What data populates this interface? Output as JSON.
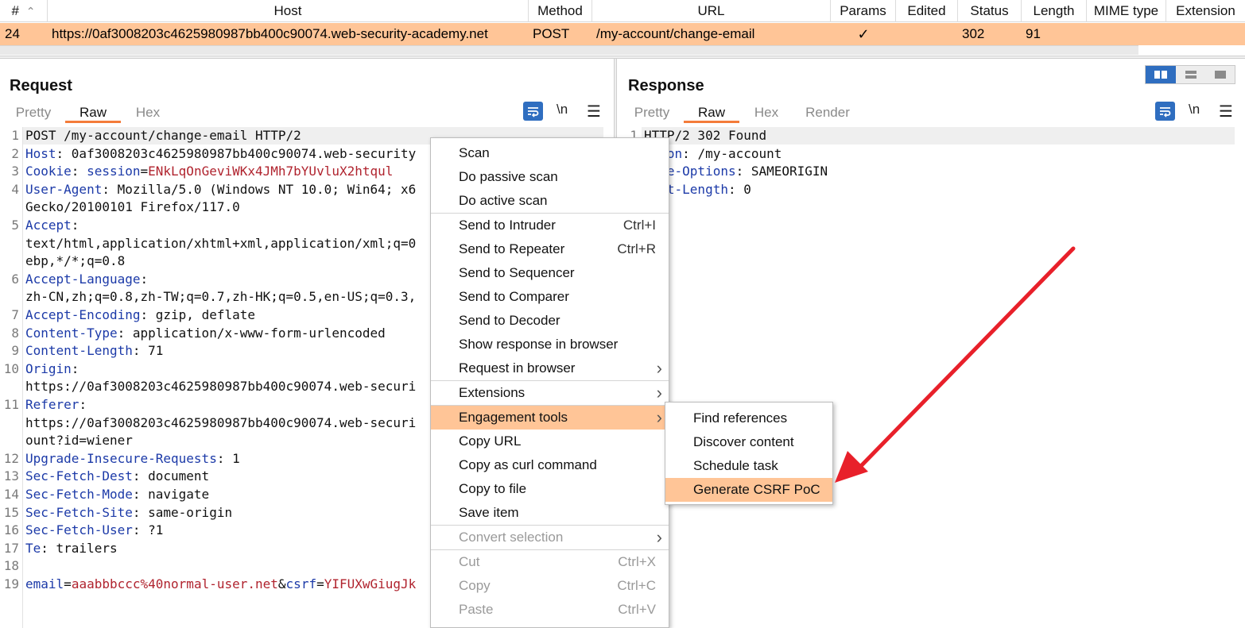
{
  "history": {
    "columns": [
      "#",
      "Host",
      "Method",
      "URL",
      "Params",
      "Edited",
      "Status",
      "Length",
      "MIME type",
      "Extension"
    ],
    "sort_indicator": "^",
    "row": {
      "num": "24",
      "host": "https://0af3008203c4625980987bb400c90074.web-security-academy.net",
      "method": "POST",
      "url": "/my-account/change-email",
      "params": "✓",
      "edited": "",
      "status": "302",
      "length": "91",
      "mime": "",
      "extension": ""
    }
  },
  "request": {
    "title": "Request",
    "tabs": [
      "Pretty",
      "Raw",
      "Hex"
    ],
    "active_tab": "Raw",
    "newline_label": "\\n",
    "lines": [
      {
        "n": "1",
        "parts": [
          [
            "plain",
            "POST /my-account/change-email HTTP/2"
          ]
        ]
      },
      {
        "n": "2",
        "parts": [
          [
            "name",
            "Host"
          ],
          [
            "plain",
            ": 0af3008203c4625980987bb400c90074.web-security"
          ]
        ]
      },
      {
        "n": "3",
        "parts": [
          [
            "name",
            "Cookie"
          ],
          [
            "plain",
            ": "
          ],
          [
            "name",
            "session"
          ],
          [
            "plain",
            "="
          ],
          [
            "pval",
            "ENkLqOnGeviWKx4JMh7bYUvluX2htqul"
          ]
        ]
      },
      {
        "n": "4",
        "parts": [
          [
            "name",
            "User-Agent"
          ],
          [
            "plain",
            ": Mozilla/5.0 (Windows NT 10.0; Win64; x6"
          ]
        ]
      },
      {
        "n": "",
        "parts": [
          [
            "plain",
            "Gecko/20100101 Firefox/117.0"
          ]
        ]
      },
      {
        "n": "5",
        "parts": [
          [
            "name",
            "Accept"
          ],
          [
            "plain",
            ":"
          ]
        ]
      },
      {
        "n": "",
        "parts": [
          [
            "plain",
            "text/html,application/xhtml+xml,application/xml;q=0"
          ]
        ]
      },
      {
        "n": "",
        "parts": [
          [
            "plain",
            "ebp,*/*;q=0.8"
          ]
        ]
      },
      {
        "n": "6",
        "parts": [
          [
            "name",
            "Accept-Language"
          ],
          [
            "plain",
            ":"
          ]
        ]
      },
      {
        "n": "",
        "parts": [
          [
            "plain",
            "zh-CN,zh;q=0.8,zh-TW;q=0.7,zh-HK;q=0.5,en-US;q=0.3,"
          ]
        ]
      },
      {
        "n": "7",
        "parts": [
          [
            "name",
            "Accept-Encoding"
          ],
          [
            "plain",
            ": gzip, deflate"
          ]
        ]
      },
      {
        "n": "8",
        "parts": [
          [
            "name",
            "Content-Type"
          ],
          [
            "plain",
            ": application/x-www-form-urlencoded"
          ]
        ]
      },
      {
        "n": "9",
        "parts": [
          [
            "name",
            "Content-Length"
          ],
          [
            "plain",
            ": 71"
          ]
        ]
      },
      {
        "n": "10",
        "parts": [
          [
            "name",
            "Origin"
          ],
          [
            "plain",
            ":"
          ]
        ]
      },
      {
        "n": "",
        "parts": [
          [
            "plain",
            "https://0af3008203c4625980987bb400c90074.web-securi"
          ]
        ]
      },
      {
        "n": "11",
        "parts": [
          [
            "name",
            "Referer"
          ],
          [
            "plain",
            ":"
          ]
        ]
      },
      {
        "n": "",
        "parts": [
          [
            "plain",
            "https://0af3008203c4625980987bb400c90074.web-securi"
          ]
        ]
      },
      {
        "n": "",
        "parts": [
          [
            "plain",
            "ount?id=wiener"
          ]
        ]
      },
      {
        "n": "12",
        "parts": [
          [
            "name",
            "Upgrade-Insecure-Requests"
          ],
          [
            "plain",
            ": 1"
          ]
        ]
      },
      {
        "n": "13",
        "parts": [
          [
            "name",
            "Sec-Fetch-Dest"
          ],
          [
            "plain",
            ": document"
          ]
        ]
      },
      {
        "n": "14",
        "parts": [
          [
            "name",
            "Sec-Fetch-Mode"
          ],
          [
            "plain",
            ": navigate"
          ]
        ]
      },
      {
        "n": "15",
        "parts": [
          [
            "name",
            "Sec-Fetch-Site"
          ],
          [
            "plain",
            ": same-origin"
          ]
        ]
      },
      {
        "n": "16",
        "parts": [
          [
            "name",
            "Sec-Fetch-User"
          ],
          [
            "plain",
            ": ?1"
          ]
        ]
      },
      {
        "n": "17",
        "parts": [
          [
            "name",
            "Te"
          ],
          [
            "plain",
            ": trailers"
          ]
        ]
      },
      {
        "n": "18",
        "parts": []
      },
      {
        "n": "19",
        "parts": [
          [
            "name",
            "email"
          ],
          [
            "plain",
            "="
          ],
          [
            "pval",
            "aaabbbccc%40normal-user.net"
          ],
          [
            "plain",
            "&"
          ],
          [
            "name",
            "csrf"
          ],
          [
            "plain",
            "="
          ],
          [
            "pval",
            "YIFUXwGiugJk"
          ]
        ]
      }
    ]
  },
  "response": {
    "title": "Response",
    "tabs": [
      "Pretty",
      "Raw",
      "Hex",
      "Render"
    ],
    "active_tab": "Raw",
    "newline_label": "\\n",
    "lines": [
      {
        "n": "1",
        "parts": [
          [
            "plain",
            "HTTP/2 302 Found"
          ]
        ]
      },
      {
        "n": "",
        "parts": [
          [
            "name",
            "ation"
          ],
          [
            "plain",
            ": /my-account"
          ]
        ]
      },
      {
        "n": "",
        "parts": [
          [
            "name",
            "rame-Options"
          ],
          [
            "plain",
            ": SAMEORIGIN"
          ]
        ]
      },
      {
        "n": "",
        "parts": [
          [
            "name",
            "tent-Length"
          ],
          [
            "plain",
            ": 0"
          ]
        ]
      }
    ]
  },
  "context_menu": {
    "items": [
      {
        "label": "Scan",
        "shortcut": "",
        "submenu": false,
        "disabled": false,
        "highlight": false
      },
      {
        "label": "Do passive scan",
        "shortcut": "",
        "submenu": false,
        "disabled": false,
        "highlight": false
      },
      {
        "label": "Do active scan",
        "shortcut": "",
        "submenu": false,
        "disabled": false,
        "highlight": false,
        "sep_after": true
      },
      {
        "label": "Send to Intruder",
        "shortcut": "Ctrl+I",
        "submenu": false,
        "disabled": false,
        "highlight": false
      },
      {
        "label": "Send to Repeater",
        "shortcut": "Ctrl+R",
        "submenu": false,
        "disabled": false,
        "highlight": false
      },
      {
        "label": "Send to Sequencer",
        "shortcut": "",
        "submenu": false,
        "disabled": false,
        "highlight": false
      },
      {
        "label": "Send to Comparer",
        "shortcut": "",
        "submenu": false,
        "disabled": false,
        "highlight": false
      },
      {
        "label": "Send to Decoder",
        "shortcut": "",
        "submenu": false,
        "disabled": false,
        "highlight": false
      },
      {
        "label": "Show response in browser",
        "shortcut": "",
        "submenu": false,
        "disabled": false,
        "highlight": false
      },
      {
        "label": "Request in browser",
        "shortcut": "",
        "submenu": true,
        "disabled": false,
        "highlight": false,
        "sep_after": true
      },
      {
        "label": "Extensions",
        "shortcut": "",
        "submenu": true,
        "disabled": false,
        "highlight": false,
        "sep_after": true
      },
      {
        "label": "Engagement tools",
        "shortcut": "",
        "submenu": true,
        "disabled": false,
        "highlight": true
      },
      {
        "label": "Copy URL",
        "shortcut": "",
        "submenu": false,
        "disabled": false,
        "highlight": false
      },
      {
        "label": "Copy as curl command",
        "shortcut": "",
        "submenu": false,
        "disabled": false,
        "highlight": false
      },
      {
        "label": "Copy to file",
        "shortcut": "",
        "submenu": false,
        "disabled": false,
        "highlight": false
      },
      {
        "label": "Save item",
        "shortcut": "",
        "submenu": false,
        "disabled": false,
        "highlight": false,
        "sep_after": true
      },
      {
        "label": "Convert selection",
        "shortcut": "",
        "submenu": true,
        "disabled": true,
        "highlight": false,
        "sep_after": true
      },
      {
        "label": "Cut",
        "shortcut": "Ctrl+X",
        "submenu": false,
        "disabled": true,
        "highlight": false
      },
      {
        "label": "Copy",
        "shortcut": "Ctrl+C",
        "submenu": false,
        "disabled": true,
        "highlight": false
      },
      {
        "label": "Paste",
        "shortcut": "Ctrl+V",
        "submenu": false,
        "disabled": true,
        "highlight": false
      }
    ]
  },
  "submenu": {
    "items": [
      {
        "label": "Find references",
        "highlight": false
      },
      {
        "label": "Discover content",
        "highlight": false
      },
      {
        "label": "Schedule task",
        "highlight": false
      },
      {
        "label": "Generate CSRF PoC",
        "highlight": true
      }
    ]
  },
  "colors": {
    "selection": "#ffc597",
    "tab_underline": "#f47c3a",
    "header_name": "#1c3aa8",
    "param_value": "#b0232e",
    "arrow": "#e8202a",
    "view_active": "#2f6ec0"
  },
  "icons": {
    "wrap": "wrap-lines-icon",
    "menu": "hamburger-menu-icon",
    "submenu_arrow": "chevron-right-icon",
    "sort": "sort-up-icon"
  }
}
